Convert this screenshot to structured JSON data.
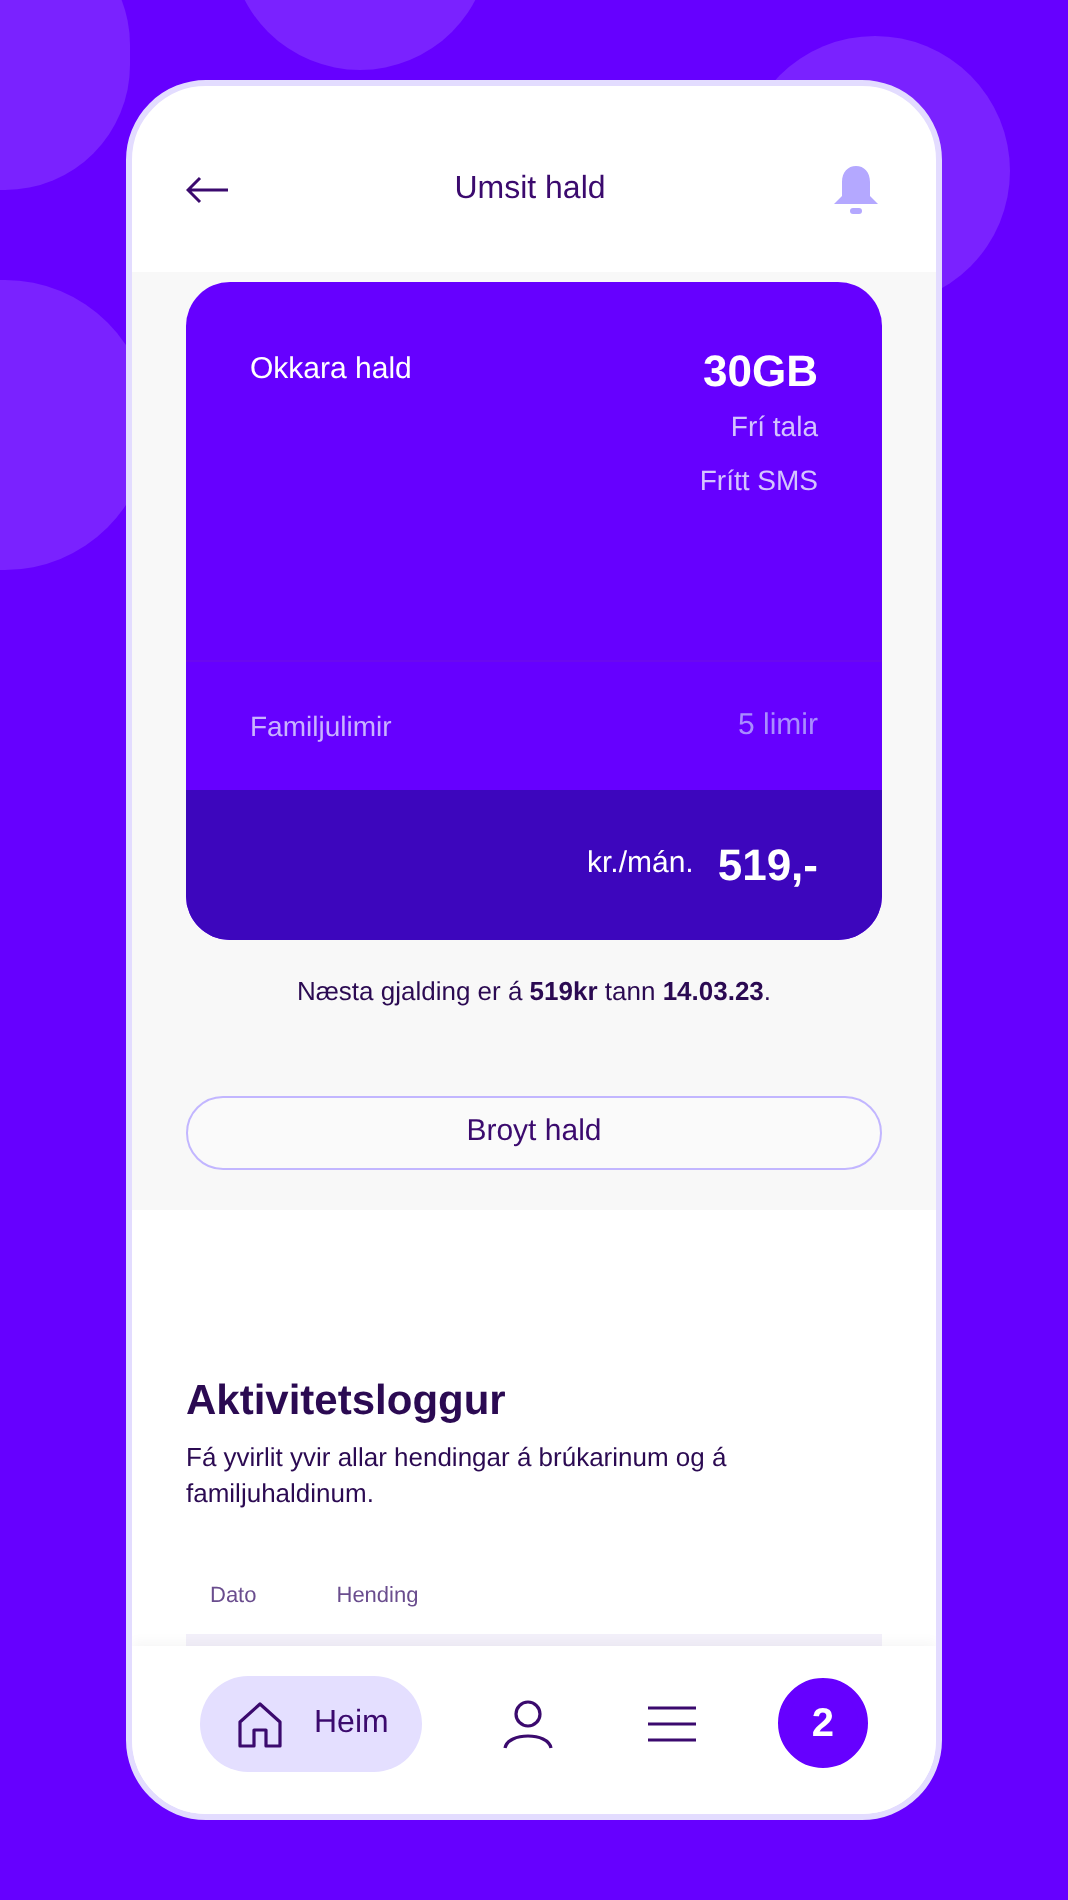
{
  "header": {
    "title": "Umsit hald"
  },
  "plan": {
    "name": "Okkara hald",
    "data": "30GB",
    "features": [
      "Frí tala",
      "Frítt SMS"
    ],
    "family_label": "Familjulimir",
    "family_value": "5 limir",
    "price_unit": "kr./mán.",
    "price": "519,-"
  },
  "billing_note": "Næsta gjalding er á **519kr** tann **14.03.23**.",
  "change_button": "Broyt hald",
  "activity": {
    "title": "Aktivitetsloggur",
    "description": "Fá yvirlit yvir allar hendingar á brúkarinum og á familjuhaldinum.",
    "columns": [
      "Dato",
      "Hending"
    ]
  },
  "nav": [
    {
      "kind": "home",
      "label": "Heim",
      "selected": true
    },
    {
      "kind": "profile",
      "selected": false
    },
    {
      "kind": "menu",
      "selected": false
    },
    {
      "kind": "logo",
      "label": "2",
      "selected": false
    }
  ]
}
